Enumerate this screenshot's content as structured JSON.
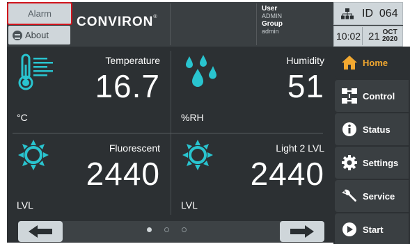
{
  "header": {
    "alarm_label": "Alarm",
    "about_label": "About",
    "brand": "CONVIRON",
    "user_label": "User",
    "user_value": "ADMIN",
    "group_label": "Group",
    "group_value": "admin",
    "id_label": "ID",
    "id_value": "064",
    "time": "10:02",
    "day": "21",
    "month": "OCT",
    "year": "2020"
  },
  "readings": [
    {
      "label": "Temperature",
      "value": "16.7",
      "unit": "°C",
      "icon": "thermometer-icon"
    },
    {
      "label": "Humidity",
      "value": "51",
      "unit": "%RH",
      "icon": "water-drops-icon"
    },
    {
      "label": "Fluorescent",
      "value": "2440",
      "unit": "LVL",
      "icon": "sun-icon"
    },
    {
      "label": "Light 2 LVL",
      "value": "2440",
      "unit": "LVL",
      "icon": "sun-icon"
    }
  ],
  "pager": {
    "pages": 3,
    "current": 1
  },
  "sidebar": {
    "items": [
      {
        "label": "Home",
        "icon": "home-icon",
        "active": true
      },
      {
        "label": "Control",
        "icon": "control-icon",
        "active": false
      },
      {
        "label": "Status",
        "icon": "info-icon",
        "active": false
      },
      {
        "label": "Settings",
        "icon": "gear-icon",
        "active": false
      },
      {
        "label": "Service",
        "icon": "wrench-icon",
        "active": false
      },
      {
        "label": "Start",
        "icon": "play-icon",
        "active": false
      }
    ]
  },
  "colors": {
    "accent_teal": "#29c4cf",
    "active_orange": "#f2a830",
    "alarm_border": "#d0141c",
    "panel_bg": "#2c3033"
  }
}
